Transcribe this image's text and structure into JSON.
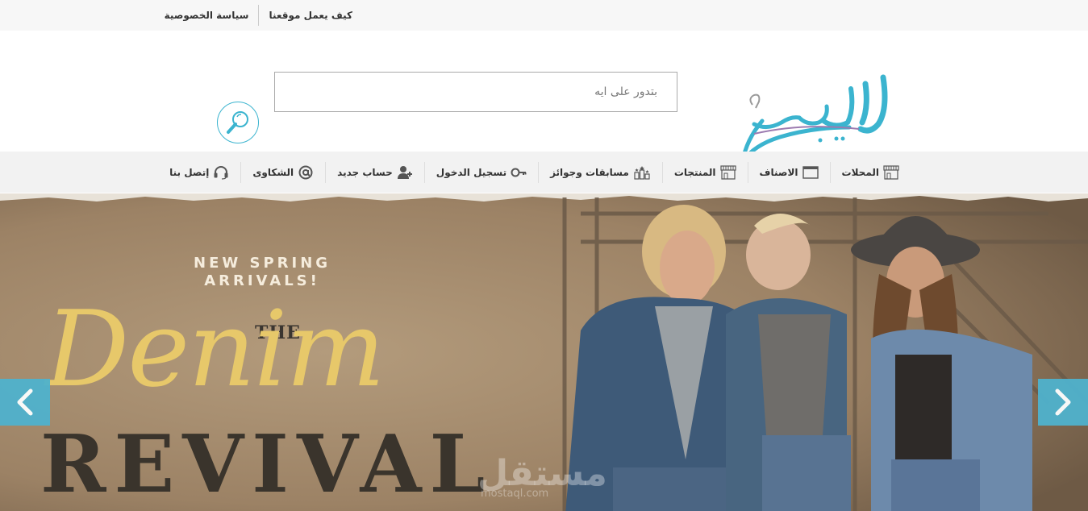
{
  "topbar": {
    "links": [
      {
        "label": "كيف يعمل موقعنا"
      },
      {
        "label": "سياسة الخصوصية"
      }
    ]
  },
  "logo": {
    "text": "اللبيس",
    "color": "#3bb4cf"
  },
  "search": {
    "placeholder": "بتدور على ايه",
    "value": ""
  },
  "nav": {
    "items": [
      {
        "label": "المحلات",
        "icon": "shop-icon"
      },
      {
        "label": "الاصناف",
        "icon": "window-icon"
      },
      {
        "label": "المنتجات",
        "icon": "shop-icon"
      },
      {
        "label": "مسابقات وجوائز",
        "icon": "trophy-icon"
      },
      {
        "label": "تسجيل الدخول",
        "icon": "key-icon"
      },
      {
        "label": "حساب جديد",
        "icon": "user-add-icon"
      },
      {
        "label": "الشكاوى",
        "icon": "at-icon"
      },
      {
        "label": "إتصل بنا",
        "icon": "headset-icon"
      }
    ]
  },
  "hero": {
    "line1": "NEW SPRING",
    "line2": "ARRIVALS!",
    "the": "THE",
    "denim": "Denim",
    "revival": "REVIVAL",
    "watermark": "مستقل",
    "watermark_sub": "mostaql.com"
  },
  "colors": {
    "accent": "#3bb4cf",
    "arrow": "#4fb2cd"
  }
}
